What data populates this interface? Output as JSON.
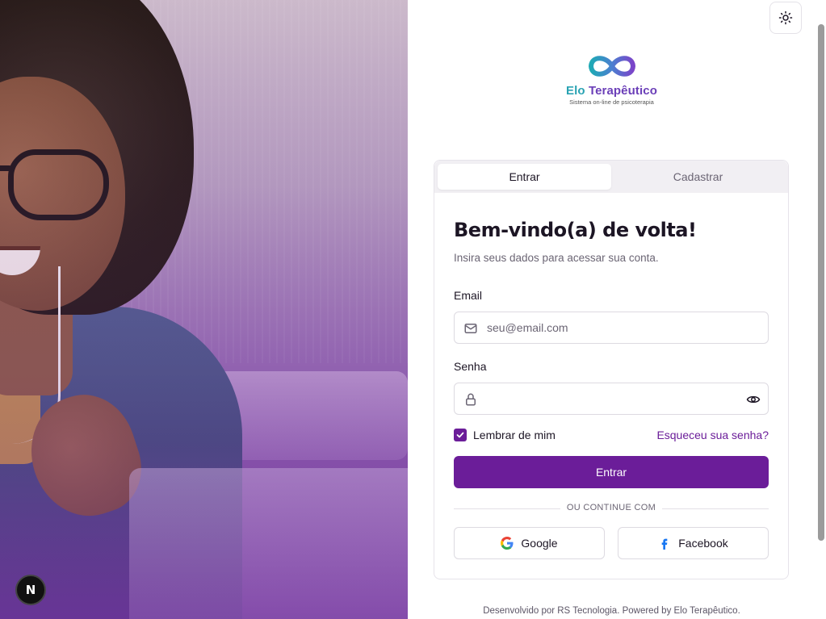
{
  "theme_toggle": {
    "icon": "sun-icon"
  },
  "logo": {
    "brand_part1": "Elo",
    "brand_part2": "Terapêutico",
    "tagline": "Sistema on-line de psicoterapia",
    "colors": {
      "teal": "#2aa3b3",
      "purple": "#6b3fb8"
    }
  },
  "tabs": [
    {
      "label": "Entrar",
      "active": true
    },
    {
      "label": "Cadastrar",
      "active": false
    }
  ],
  "login": {
    "title": "Bem-vindo(a) de volta!",
    "subtitle": "Insira seus dados para acessar sua conta.",
    "email_label": "Email",
    "email_placeholder": "seu@email.com",
    "email_value": "",
    "password_label": "Senha",
    "password_value": "",
    "remember_label": "Lembrar de mim",
    "remember_checked": true,
    "forgot_label": "Esqueceu sua senha?",
    "submit_label": "Entrar",
    "divider_text": "OU CONTINUE COM",
    "google_label": "Google",
    "facebook_label": "Facebook"
  },
  "footer": {
    "text": "Desenvolvido por RS Tecnologia. Powered by Elo Terapêutico."
  },
  "dev_badge": {
    "letter": "N"
  },
  "colors": {
    "primary": "#6b1d99",
    "text": "#1c1524",
    "muted": "#6b6574"
  }
}
